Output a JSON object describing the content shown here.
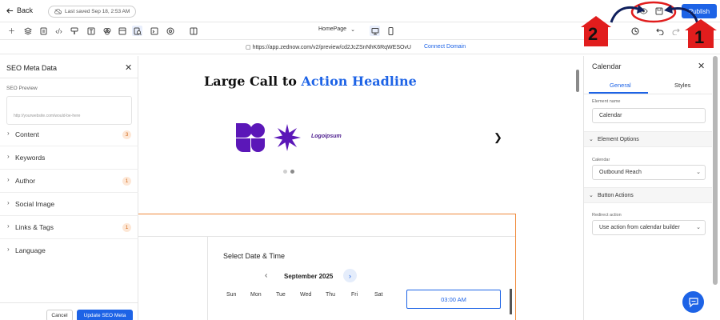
{
  "topbar": {
    "back_label": "Back",
    "saved_label": "Last saved Sep 18, 2:53 AM",
    "publish_label": "Publish",
    "preview_icon": "eye-icon",
    "save_icon": "save-icon"
  },
  "toolbar": {
    "page_select": "HomePage",
    "tools": [
      "add-icon",
      "layers-icon",
      "pages-icon",
      "code-icon",
      "brush-icon",
      "text-icon",
      "color-icon",
      "media-icon",
      "section-icon",
      "seo-icon",
      "terminal-icon",
      "global-icon",
      "sidebar-icon"
    ],
    "device_desktop": "desktop-icon",
    "device_mobile": "mobile-icon",
    "history_icon": "history-icon",
    "undo_icon": "undo-icon",
    "redo_icon": "redo-icon"
  },
  "urlbar": {
    "url": "https://app.zednow.com/v2/preview/cd2JcZSnNhK6RqWESOvU",
    "connect_label": "Connect Domain"
  },
  "seo_panel": {
    "title": "SEO Meta Data",
    "preview_label": "SEO Preview",
    "preview_url": "http://yourwebsite.com/would-be-here",
    "sections": [
      {
        "label": "Content",
        "badge": "3"
      },
      {
        "label": "Keywords",
        "badge": ""
      },
      {
        "label": "Author",
        "badge": "1"
      },
      {
        "label": "Social Image",
        "badge": ""
      },
      {
        "label": "Links & Tags",
        "badge": "1"
      },
      {
        "label": "Language",
        "badge": ""
      }
    ],
    "cancel_label": "Cancel",
    "update_label": "Update SEO Meta"
  },
  "canvas": {
    "headline_prefix": "Large Call to ",
    "headline_accent": "Action Headline",
    "logo_text": "Logoipsum",
    "calendar": {
      "title": "Select Date & Time",
      "month": "September 2025",
      "days": [
        "Sun",
        "Mon",
        "Tue",
        "Wed",
        "Thu",
        "Fri",
        "Sat"
      ],
      "time_slot": "03:00 AM"
    }
  },
  "right_panel": {
    "title": "Calendar",
    "tab_general": "General",
    "tab_styles": "Styles",
    "element_name_label": "Element name",
    "element_name_value": "Calendar",
    "element_options_label": "Element Options",
    "calendar_label": "Calendar",
    "calendar_value": "Outbound Reach",
    "button_actions_label": "Button Actions",
    "redirect_label": "Redirect action",
    "redirect_value": "Use action from calendar builder"
  },
  "annotations": {
    "step1": "1",
    "step2": "2",
    "color": "#e11d1d"
  },
  "colors": {
    "accent": "#1d63e6",
    "badge_bg": "#fde7d6",
    "badge_text": "#d26a1c",
    "frame_orange": "#f08a3c",
    "logo_purple": "#5b17b8"
  }
}
